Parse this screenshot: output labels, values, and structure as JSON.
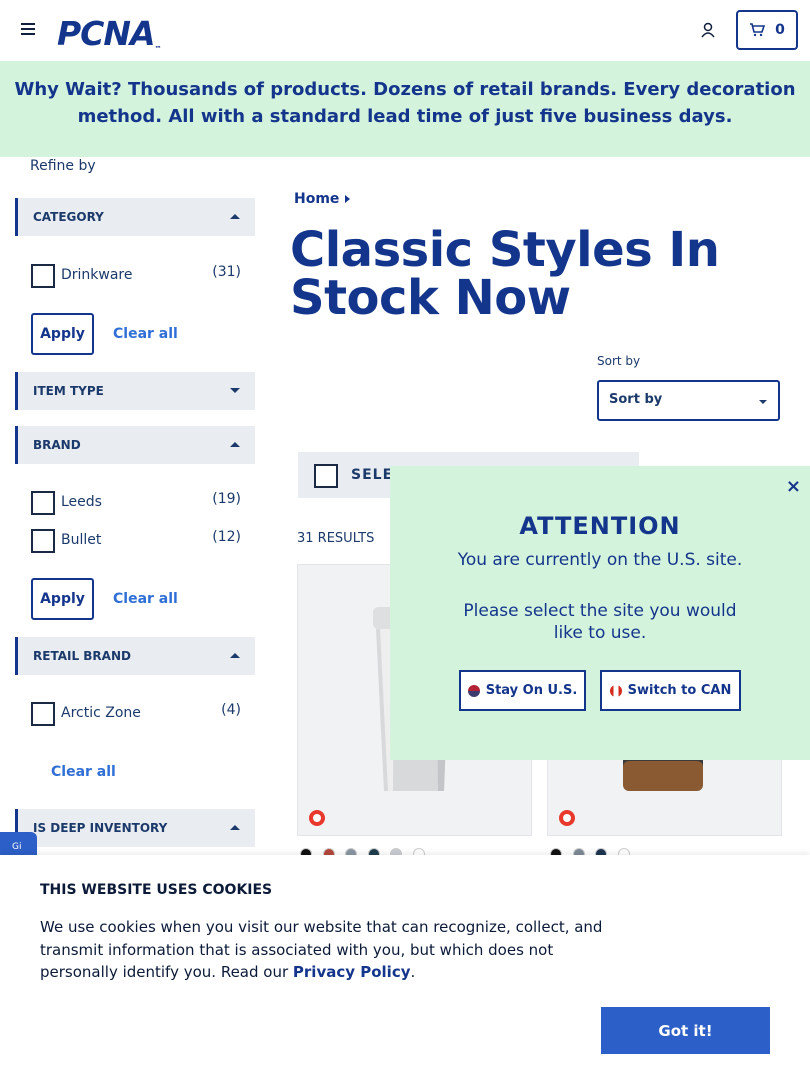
{
  "header": {
    "logo_text": "PCNA",
    "logo_tm": "™",
    "cart_count": "0"
  },
  "banner": {
    "lead": "Why Wait?",
    "text": " Thousands of products. Dozens of retail brands. Every decoration method. All with a standard lead time of just five business days."
  },
  "sidebar": {
    "refine_label": "Refine by",
    "facets": [
      {
        "title": "CATEGORY",
        "options": [
          {
            "label": "Drinkware",
            "count": "(31)"
          }
        ],
        "apply": "Apply",
        "clear": "Clear all"
      },
      {
        "title": "ITEM TYPE"
      },
      {
        "title": "BRAND",
        "options": [
          {
            "label": "Leeds",
            "count": "(19)"
          },
          {
            "label": "Bullet",
            "count": "(12)"
          }
        ],
        "apply": "Apply",
        "clear": "Clear all"
      },
      {
        "title": "RETAIL BRAND",
        "options": [
          {
            "label": "Arctic Zone",
            "count": "(4)"
          }
        ],
        "clear": "Clear all"
      },
      {
        "title": "IS DEEP INVENTORY"
      }
    ]
  },
  "main": {
    "breadcrumb": "Home",
    "title": "Classic Styles In Stock Now",
    "sort_label": "Sort by",
    "sort_value": "Sort by",
    "select_all": "SELEC",
    "results": "31 RESULTS"
  },
  "product_swatches": {
    "card1": [
      "#111111",
      "#b5483c",
      "#8a96a3",
      "#1f3f4f",
      "#c9ccd4",
      "#ffffff"
    ],
    "card2": [
      "#111111",
      "#7d8a96",
      "#1e3550",
      "#ffffff"
    ]
  },
  "modal": {
    "close": "×",
    "title": "ATTENTION",
    "line1": "You are currently on the U.S. site.",
    "line2": "Please select the site you would like to use.",
    "stay": "Stay On U.S.",
    "switch": "Switch to CAN"
  },
  "side_tab": "Gi",
  "cookie": {
    "title": "THIS WEBSITE USES COOKIES",
    "text": "We use cookies when you visit our website that can recognize, collect, and transmit information that is associated with you, but which does not personally identify you. Read our ",
    "link": "Privacy Policy",
    "end": ".",
    "button": "Got it!"
  },
  "colors": {
    "brand": "#14358c",
    "banner_bg": "#d4f3dc",
    "button_blue": "#2c5fc7",
    "badge_red": "#e8392c"
  }
}
